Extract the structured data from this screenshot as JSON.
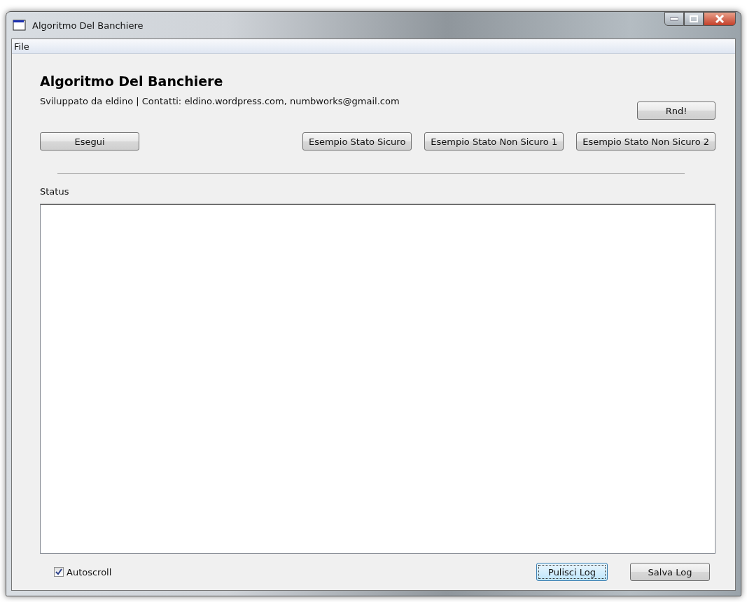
{
  "window": {
    "title": "Algoritmo Del Banchiere"
  },
  "menu": [
    {
      "label": "File"
    }
  ],
  "heading": "Algoritmo Del Banchiere",
  "credits": "Sviluppato da eldino | Contatti: eldino.wordpress.com, numbworks@gmail.com",
  "rnd_button": {
    "label": "Rnd!",
    "focused": false
  },
  "run_button": {
    "label": "Esegui",
    "focused": false
  },
  "example_buttons": [
    {
      "label": "Esempio Stato Sicuro",
      "focused": false
    },
    {
      "label": "Esempio Stato Non Sicuro 1",
      "focused": false
    },
    {
      "label": "Esempio Stato Non Sicuro 2",
      "focused": false
    }
  ],
  "status": {
    "label": "Status"
  },
  "autoscroll": {
    "label": "Autoscroll",
    "checked": true
  },
  "log_buttons": [
    {
      "label": "Pulisci Log",
      "focused": true
    },
    {
      "label": "Salva Log",
      "focused": false
    }
  ]
}
